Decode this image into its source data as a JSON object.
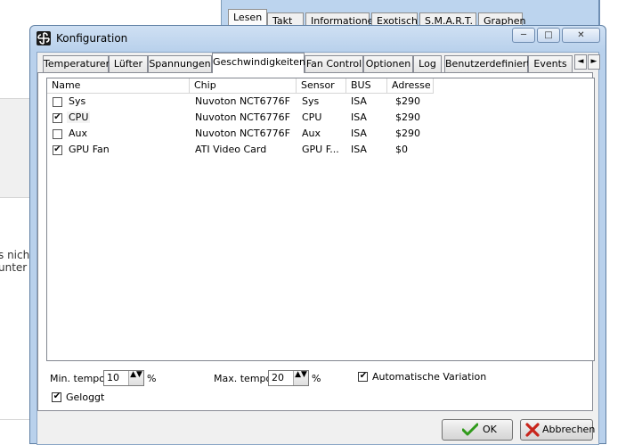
{
  "background": {
    "left_text_lines": [
      "s nich",
      "unter"
    ],
    "right_tabs": [
      {
        "label": "Lesen",
        "active": true
      },
      {
        "label": "Takt",
        "active": false
      },
      {
        "label": "Informationen",
        "active": false
      },
      {
        "label": "Exotisch",
        "active": false
      },
      {
        "label": "S.M.A.R.T.",
        "active": false
      },
      {
        "label": "Graphen",
        "active": false
      }
    ]
  },
  "dialog": {
    "title": "Konfiguration",
    "caption_buttons": {
      "minimize": "─",
      "maximize": "□",
      "close": "✕"
    },
    "tabs": [
      {
        "label": "Temperaturen"
      },
      {
        "label": "Lüfter"
      },
      {
        "label": "Spannungen"
      },
      {
        "label": "Geschwindigkeiten"
      },
      {
        "label": "Fan Control"
      },
      {
        "label": "Optionen"
      },
      {
        "label": "Log"
      },
      {
        "label": "Benutzerdefiniert"
      },
      {
        "label": "Events"
      }
    ],
    "active_tab": "Geschwindigkeiten",
    "tab_scroll": {
      "left": "◄",
      "right": "►"
    },
    "list": {
      "columns": [
        "Name",
        "Chip",
        "Sensor",
        "BUS",
        "Adresse"
      ],
      "rows": [
        {
          "checked": false,
          "name": "Sys",
          "chip": "Nuvoton NCT6776F",
          "sensor": "Sys",
          "bus": "ISA",
          "address": "$290"
        },
        {
          "checked": true,
          "name": "CPU",
          "chip": "Nuvoton NCT6776F",
          "sensor": "CPU",
          "bus": "ISA",
          "address": "$290"
        },
        {
          "checked": false,
          "name": "Aux",
          "chip": "Nuvoton NCT6776F",
          "sensor": "Aux",
          "bus": "ISA",
          "address": "$290"
        },
        {
          "checked": true,
          "name": "GPU Fan",
          "chip": "ATI Video Card",
          "sensor": "GPU F...",
          "bus": "ISA",
          "address": "$0"
        }
      ],
      "check_glyph": "✔"
    },
    "min_tempo": {
      "label": "Min. tempo",
      "value": "10",
      "unit": "%"
    },
    "max_tempo": {
      "label": "Max. tempo",
      "value": "20",
      "unit": "%"
    },
    "auto_variation": {
      "label": "Automatische Variation",
      "checked": true
    },
    "logged": {
      "label": "Geloggt",
      "checked": true
    },
    "buttons": {
      "ok": "OK",
      "cancel": "Abbrechen"
    },
    "spin_arrows": "▲▼"
  },
  "colors": {
    "ok_icon": "#2f9a1a",
    "cancel_icon": "#c8251c",
    "title_gradient_top": "#cfe0f3",
    "window_frame": "#b9d1ec"
  }
}
